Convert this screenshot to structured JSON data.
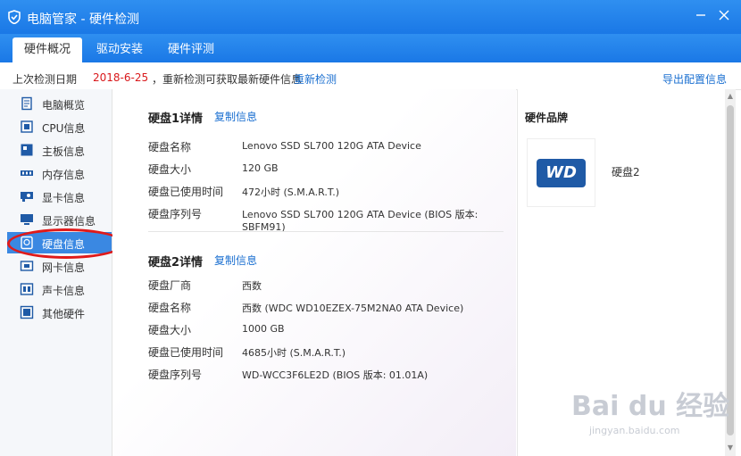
{
  "window": {
    "title": "电脑管家 - 硬件检测"
  },
  "tabs": [
    {
      "label": "硬件概况",
      "active": true
    },
    {
      "label": "驱动安装",
      "active": false
    },
    {
      "label": "硬件评测",
      "active": false
    }
  ],
  "infobar": {
    "prefix": "上次检测日期",
    "date": "2018-6-25",
    "message": "，重新检测可获取最新硬件信息",
    "recheck_label": "重新检测",
    "export_label": "导出配置信息"
  },
  "sidebar": {
    "items": [
      {
        "label": "电脑概览",
        "icon": "overview-icon"
      },
      {
        "label": "CPU信息",
        "icon": "cpu-icon"
      },
      {
        "label": "主板信息",
        "icon": "motherboard-icon"
      },
      {
        "label": "内存信息",
        "icon": "memory-icon"
      },
      {
        "label": "显卡信息",
        "icon": "graphics-card-icon"
      },
      {
        "label": "显示器信息",
        "icon": "monitor-icon"
      },
      {
        "label": "硬盘信息",
        "icon": "harddisk-icon",
        "active": true
      },
      {
        "label": "网卡信息",
        "icon": "network-card-icon"
      },
      {
        "label": "声卡信息",
        "icon": "sound-card-icon"
      },
      {
        "label": "其他硬件",
        "icon": "other-hardware-icon"
      }
    ]
  },
  "disk1": {
    "title": "硬盘1详情",
    "copy_label": "复制信息",
    "rows": [
      {
        "key": "硬盘名称",
        "value": "Lenovo SSD SL700 120G ATA Device"
      },
      {
        "key": "硬盘大小",
        "value": "120 GB"
      },
      {
        "key": "硬盘已使用时间",
        "value": "472小时 (S.M.A.R.T.)"
      },
      {
        "key": "硬盘序列号",
        "value": "Lenovo SSD SL700 120G ATA Device (BIOS 版本: SBFM91)"
      }
    ]
  },
  "disk2": {
    "title": "硬盘2详情",
    "copy_label": "复制信息",
    "rows": [
      {
        "key": "硬盘厂商",
        "value": "西数"
      },
      {
        "key": "硬盘名称",
        "value": "西数 (WDC WD10EZEX-75M2NA0 ATA Device)"
      },
      {
        "key": "硬盘大小",
        "value": "1000 GB"
      },
      {
        "key": "硬盘已使用时间",
        "value": "4685小时 (S.M.A.R.T.)"
      },
      {
        "key": "硬盘序列号",
        "value": "WD-WCC3F6LE2D (BIOS 版本: 01.01A)"
      }
    ]
  },
  "brand": {
    "title": "硬件品牌",
    "logo_text": "WD",
    "label": "硬盘2"
  },
  "watermark": {
    "main": "Bai du 经验",
    "sub": "jingyan.baidu.com"
  }
}
